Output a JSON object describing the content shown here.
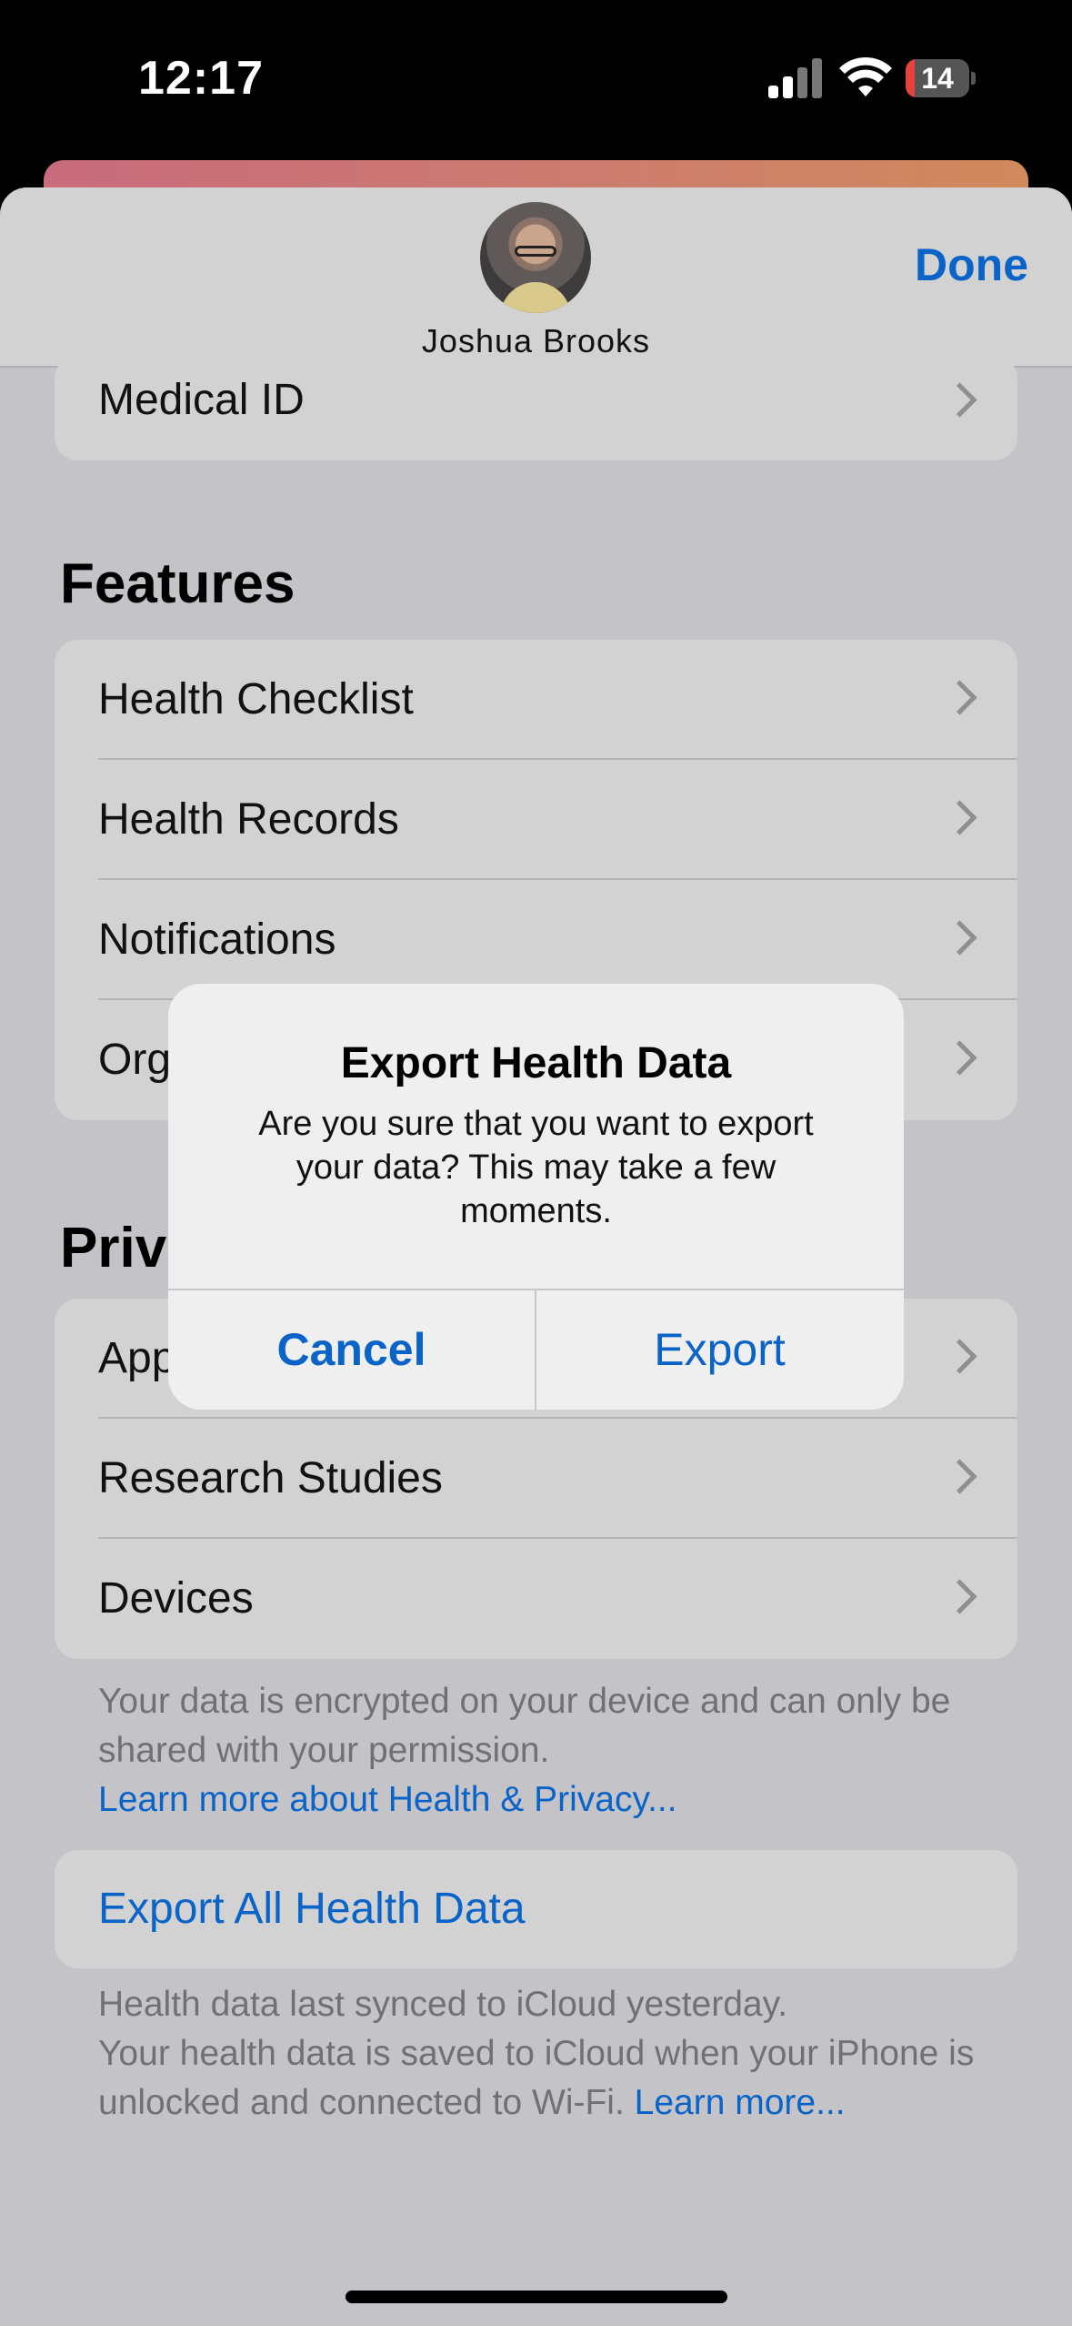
{
  "status": {
    "time": "12:17",
    "battery": "14",
    "battery_level": 0.14
  },
  "header": {
    "user_name": "Joshua Brooks",
    "done_label": "Done"
  },
  "top_group": {
    "items": [
      {
        "label": "Medical ID"
      }
    ]
  },
  "features": {
    "title": "Features",
    "items": [
      {
        "label": "Health Checklist"
      },
      {
        "label": "Health Records"
      },
      {
        "label": "Notifications"
      },
      {
        "label": "Org"
      }
    ]
  },
  "privacy": {
    "title": "Priv",
    "items": [
      {
        "label": "App"
      },
      {
        "label": "Research Studies"
      },
      {
        "label": "Devices"
      }
    ],
    "note": "Your data is encrypted on your device and can only be shared with your permission.",
    "note_link": "Learn more about Health & Privacy..."
  },
  "export_section": {
    "button_label": "Export All Health Data",
    "note_line1": "Health data last synced to iCloud yesterday.",
    "note_line2": "Your health data is saved to iCloud when your iPhone is unlocked and connected to Wi-Fi.",
    "note_link": "Learn more..."
  },
  "alert": {
    "title": "Export Health Data",
    "message": "Are you sure that you want to export your data? This may take a few moments.",
    "cancel_label": "Cancel",
    "export_label": "Export"
  },
  "colors": {
    "accent": "#0a64c8",
    "battery_low": "#e5423b"
  }
}
